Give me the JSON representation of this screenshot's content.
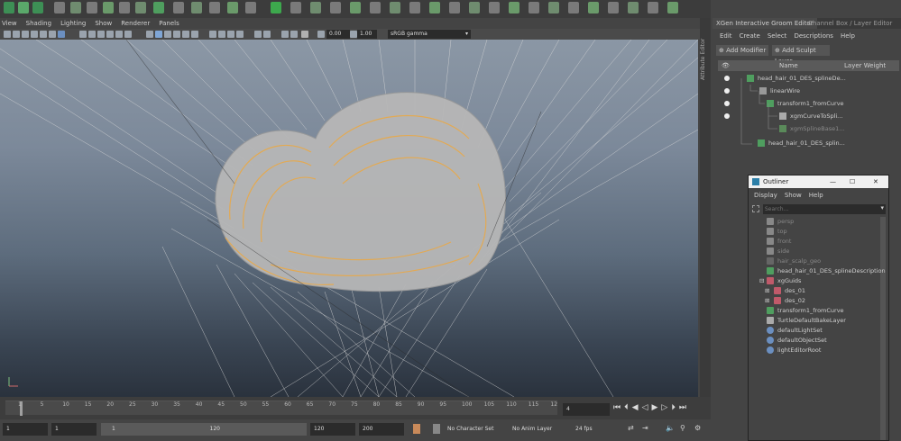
{
  "viewport": {
    "menu": [
      "View",
      "Shading",
      "Lighting",
      "Show",
      "Renderer",
      "Panels"
    ],
    "exposure": "0.00",
    "gamma": "1.00",
    "color_space": "sRGB gamma"
  },
  "attribute_tab": "Attribute Editor",
  "timeline": {
    "ticks": [
      "1",
      "5",
      "10",
      "15",
      "20",
      "25",
      "30",
      "35",
      "40",
      "45",
      "50",
      "55",
      "60",
      "65",
      "70",
      "75",
      "80",
      "85",
      "90",
      "95",
      "100",
      "105",
      "110",
      "115",
      "12"
    ],
    "current_frame": "4"
  },
  "range": {
    "start": "1",
    "start2": "1",
    "slider_start": "1",
    "slider_end": "120",
    "end": "120",
    "end2": "200",
    "char_set": "No Character Set",
    "anim_layer": "No Anim Layer",
    "fps": "24 fps"
  },
  "xgen": {
    "tabs": [
      "XGen Interactive Groom Editor",
      "Channel Box / Layer Editor"
    ],
    "menu": [
      "Edit",
      "Create",
      "Select",
      "Descriptions",
      "Help"
    ],
    "add_modifier": "Add Modifier",
    "add_sculpt": "Add Sculpt Layer",
    "col_name": "Name",
    "col_weight": "Layer Weight",
    "rows": [
      "head_hair_01_DES_splineDe...",
      "linearWire",
      "transform1_fromCurve",
      "xgmCurveToSpli...",
      "xgmSplineBase1...",
      "head_hair_01_DES_splin..."
    ]
  },
  "outliner": {
    "title": "Outliner",
    "menu": [
      "Display",
      "Show",
      "Help"
    ],
    "search_placeholder": "Search...",
    "items": [
      "persp",
      "top",
      "front",
      "side",
      "hair_scalp_geo",
      "head_hair_01_DES_splineDescription",
      "xgGuids",
      "des_01",
      "des_02",
      "transform1_fromCurve",
      "TurtleDefaultBakeLayer",
      "defaultLightSet",
      "defaultObjectSet",
      "lightEditorRoot"
    ]
  }
}
